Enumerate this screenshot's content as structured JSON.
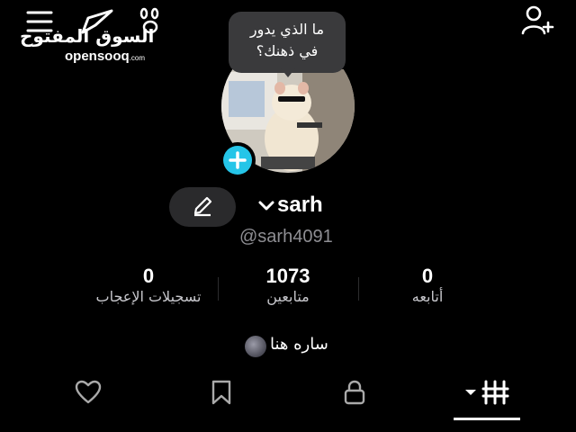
{
  "watermark": {
    "arabic": "السوق المفتوح",
    "latin": "opensooq",
    "suffix": ".com"
  },
  "bubble": {
    "text": "ما الذي يدور\nفي ذهنك؟"
  },
  "profile": {
    "username": "sarh",
    "handle": "@sarh4091",
    "bio": "ساره هنا"
  },
  "stats": [
    {
      "value": "0",
      "label": "تسجيلات الإعجاب"
    },
    {
      "value": "1073",
      "label": "متابعين"
    },
    {
      "value": "0",
      "label": "أتابعه"
    }
  ],
  "icons": {
    "menu": "hamburger-icon",
    "send": "send-icon",
    "paw": "paw-icon",
    "add_user": "add-user-icon",
    "edit": "pencil-icon",
    "add_story": "plus-icon",
    "chevron": "chevron-down-icon",
    "tabs": [
      "heart-icon",
      "bookmark-icon",
      "lock-icon",
      "grid-icon"
    ]
  },
  "colors": {
    "background": "#000000",
    "accent": "#25c5e8",
    "bubble": "#3a3a3c",
    "muted": "#8e8e93"
  }
}
